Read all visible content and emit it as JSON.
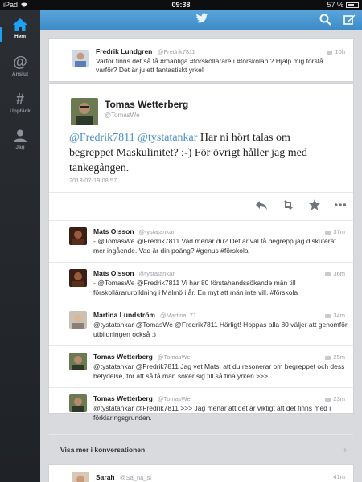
{
  "status": {
    "carrier": "iPad",
    "time": "09:38",
    "battery": "57 %"
  },
  "sidebar": {
    "items": [
      {
        "label": "Hem",
        "icon": "home-icon",
        "active": true
      },
      {
        "label": "Anslut",
        "icon": "at-icon",
        "active": false
      },
      {
        "label": "Upptäck",
        "icon": "hash-icon",
        "active": false
      },
      {
        "label": "Jag",
        "icon": "person-icon",
        "active": false
      }
    ]
  },
  "header": {
    "logo": "twitter-bird-icon",
    "search_icon": "search-icon",
    "compose_icon": "compose-icon"
  },
  "top_tweet": {
    "name": "Fredrik Lundgren",
    "handle": "@Fredrik7811",
    "time": "10h",
    "text": "Varför finns det så få #manliga #förskollärare i #förskolan ? Hjälp mig förstå varför? Det är ju ett fantastiskt yrke!"
  },
  "focus_tweet": {
    "name": "Tomas Wetterberg",
    "handle": "@TomasWe",
    "mention1": "@Fredrik7811",
    "mention2": "@tystatankar",
    "text": "Har ni hört talas om begreppet Maskulinitet? ;-) För övrigt håller jag med tankegången.",
    "timestamp": "2013-07-19 08:57"
  },
  "replies": [
    {
      "name": "Mats Olsson",
      "handle": "@tystatankar",
      "time": "37m",
      "text": "- @TomasWe @Fredrik7811 Vad menar du? Det är väl få begrepp jag diskuterat mer ingående. Vad är din poäng? #genus #förskola"
    },
    {
      "name": "Mats Olsson",
      "handle": "@tystatankar",
      "time": "36m",
      "text": "- @TomasWe @Fredrik7811 Vi har 80 förstahandssökande män till förskollärarurbildning i Malmö i år. En myt att män inte vill. #förskola"
    },
    {
      "name": "Martina Lundström",
      "handle": "@MartinaL71",
      "time": "34m",
      "text": "@tystatankar @TomasWe @Fredrik7811 Härligt! Hoppas alla 80 väljer att genomför utbildningen också :)"
    },
    {
      "name": "Tomas Wetterberg",
      "handle": "@TomasWe",
      "time": "25m",
      "text": "@tystatankar @Fredrik7811 Jag vet Mats, att du resonerar om begreppet och dess betydelse, för att så få män söker sig till så fina yrken.>>>"
    },
    {
      "name": "Tomas Wetterberg",
      "handle": "@TomasWe",
      "time": "23m",
      "text": "@tystatankar @Fredrik7811 >>> Jag menar att det är viktigt att det finns med i förklaringsgrunden."
    }
  ],
  "more_label": "Visa mer i konversationen",
  "bottom_tweet": {
    "name": "Sarah",
    "handle": "@Sa_na_si",
    "time": "41m"
  }
}
